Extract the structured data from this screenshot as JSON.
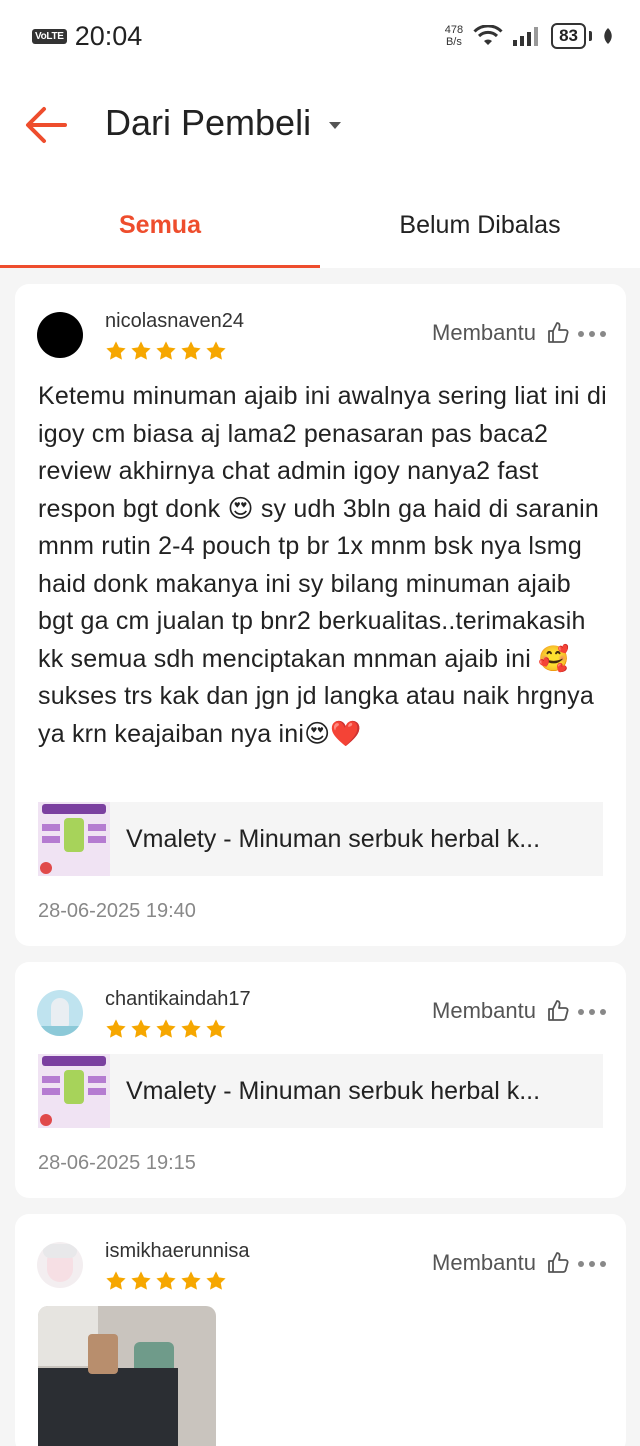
{
  "status_bar": {
    "volte": "VoLTE",
    "time": "20:04",
    "net_speed_value": "478",
    "net_speed_unit": "B/s",
    "battery": "83"
  },
  "header": {
    "title": "Dari Pembeli"
  },
  "tabs": [
    {
      "label": "Semua",
      "active": true
    },
    {
      "label": "Belum Dibalas",
      "active": false
    }
  ],
  "colors": {
    "accent": "#ee4d2d",
    "star": "#f6a700"
  },
  "reviews": [
    {
      "username": "nicolasnaven24",
      "rating": 5,
      "helpful_label": "Membantu",
      "text": "Ketemu minuman ajaib ini awalnya sering liat ini di igoy cm biasa aj lama2 penasaran pas baca2 review akhirnya chat admin igoy nanya2 fast respon bgt donk 😍 sy udh 3bln ga haid di saranin mnm rutin 2-4 pouch tp br 1x mnm bsk nya lsmg haid donk makanya ini sy bilang minuman ajaib bgt ga cm jualan tp bnr2 berkualitas..terimakasih kk semua sdh menciptakan mnman ajaib ini 🥰 sukses trs kak dan jgn jd langka atau naik hrgnya ya krn keajaiban nya ini😍❤️",
      "product_name": "Vmalety - Minuman serbuk herbal k...",
      "date": "28-06-2025 19:40"
    },
    {
      "username": "chantikaindah17",
      "rating": 5,
      "helpful_label": "Membantu",
      "product_name": "Vmalety - Minuman serbuk herbal k...",
      "date": "28-06-2025 19:15"
    },
    {
      "username": "ismikhaerunnisa",
      "rating": 5,
      "helpful_label": "Membantu"
    }
  ]
}
